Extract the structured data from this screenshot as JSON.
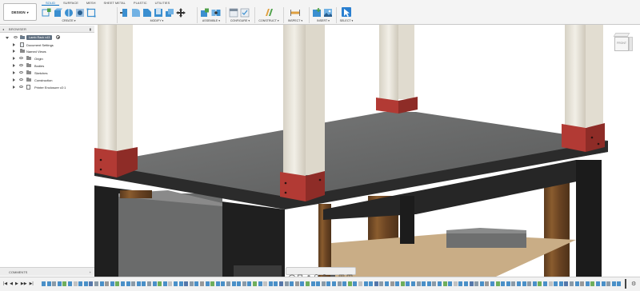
{
  "toolbar": {
    "workspace": {
      "label": "DESIGN",
      "caret": "▾"
    },
    "tabs": [
      "SOLID",
      "SURFACE",
      "MESH",
      "SHEET METAL",
      "PLASTIC",
      "UTILITIES"
    ],
    "active_tab": "SOLID",
    "groups": {
      "create": "CREATE ▾",
      "modify": "MODIFY ▾",
      "assemble": "ASSEMBLE ▾",
      "configure": "CONFIGURE ▾",
      "construct": "CONSTRUCT ▾",
      "inspect": "INSPECT ▾",
      "insert": "INSERT ▾",
      "select": "SELECT ▾"
    },
    "icons": {
      "create": [
        "new-component-icon",
        "extrude-icon",
        "revolve-icon",
        "hole-icon",
        "box-icon"
      ],
      "modify": [
        "press-pull-icon",
        "fillet-icon",
        "chamfer-icon",
        "shell-icon",
        "combine-icon",
        "move-icon"
      ],
      "assemble": [
        "new-component-icon",
        "joint-icon"
      ],
      "configure": [
        "configure-table-icon",
        "configure-rule-icon"
      ],
      "construct": [
        "offset-plane-icon"
      ],
      "inspect": [
        "measure-icon"
      ],
      "insert": [
        "insert-image-icon",
        "decal-icon"
      ],
      "select": [
        "select-arrow-icon"
      ]
    }
  },
  "browser": {
    "title": "BROWSER",
    "collapse_glyph": "◂",
    "pin_glyph": "▮",
    "root": {
      "label": "Lamb Rack v43"
    },
    "items": [
      {
        "label": "Document Settings",
        "icon": "settings-icon"
      },
      {
        "label": "Named Views",
        "icon": "folder-icon"
      },
      {
        "label": "Origin",
        "icon": "folder-icon"
      },
      {
        "label": "Bodies",
        "icon": "folder-icon"
      },
      {
        "label": "Sketches",
        "icon": "folder-icon"
      },
      {
        "label": "Construction",
        "icon": "folder-icon"
      },
      {
        "label": "Printer Enclosure v2:1",
        "icon": "external-component-icon"
      }
    ]
  },
  "comments": {
    "title": "COMMENTS",
    "toggle_glyph": "+"
  },
  "viewcube": {
    "face": "FRONT"
  },
  "timeline": {
    "controls": [
      "|◀",
      "◀",
      "▶",
      "▶▶",
      "▶|"
    ],
    "settings_glyph": "⚙",
    "feature_colors": [
      "#4a90c8",
      "#8a9aa8",
      "#6fae5c",
      "#c2c2c2",
      "#5577aa",
      "#999999"
    ]
  },
  "colors": {
    "wood_post": "#ebe7dc",
    "bracket": "#b23a34",
    "tabletop": "#6a6b6b",
    "frame": "#1f1f1f",
    "plywood": "#c9ad86",
    "accent": "#0a6fc2"
  }
}
